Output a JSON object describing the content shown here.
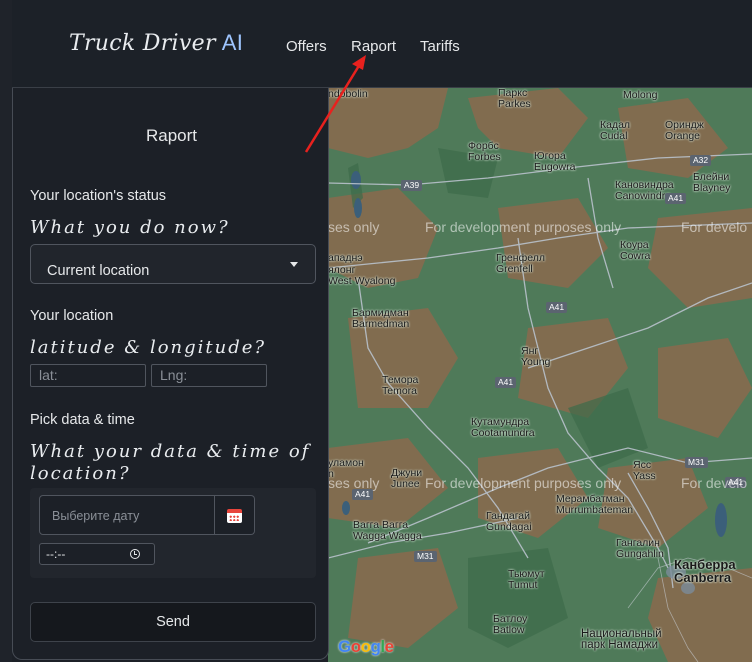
{
  "navbar": {
    "brand": "Truck Driver",
    "brand_suffix": "AI",
    "links": [
      "Offers",
      "Raport",
      "Tariffs"
    ]
  },
  "panel": {
    "title": "Raport",
    "status_label": "Your location's status",
    "status_question": "What you do now?",
    "status_select_value": "Current location",
    "location_label": "Your location",
    "location_question": "latitude & longitude?",
    "lat_placeholder": "lat:",
    "lng_placeholder": "Lng:",
    "datetime_label": "Pick data & time",
    "datetime_question": "What your data & time of location?",
    "date_placeholder": "Выберите дату",
    "time_value": "--:--",
    "send_label": "Send"
  },
  "map": {
    "watermark": "For development purposes only",
    "watermark_left": "ses only",
    "watermark_right": "For develo",
    "logo": "Google",
    "places": [
      {
        "ru": "Паркс",
        "en": "Parkes"
      },
      {
        "ru": "Molong",
        "en": ""
      },
      {
        "ru": "Кадал",
        "en": "Cudal"
      },
      {
        "ru": "Ориндж",
        "en": "Orange"
      },
      {
        "ru": "Форбс",
        "en": "Forbes"
      },
      {
        "ru": "Югора",
        "en": "Eugowra"
      },
      {
        "ru": "Кановиндра",
        "en": "Canowindra"
      },
      {
        "ru": "Блейни",
        "en": "Blayney"
      },
      {
        "ru": "Коура",
        "en": "Cowra"
      },
      {
        "ru": "Гренфелл",
        "en": "Grenfell"
      },
      {
        "ru": "ападнэ",
        "en": ""
      },
      {
        "ru": "ялонг",
        "en": "West Wyalong"
      },
      {
        "ru": "Бармидман",
        "en": "Barmedman"
      },
      {
        "ru": "Янг",
        "en": "Young"
      },
      {
        "ru": "Темора",
        "en": "Temora"
      },
      {
        "ru": "Кутамундра",
        "en": "Cootamundra"
      },
      {
        "ru": "уламон",
        "en": "n"
      },
      {
        "ru": "Джуни",
        "en": "Junee"
      },
      {
        "ru": "Ясс",
        "en": "Yass"
      },
      {
        "ru": "Мерамбатман",
        "en": "Murrumbateman"
      },
      {
        "ru": "Гандагай",
        "en": "Gundagai"
      },
      {
        "ru": "Вагга Вагга",
        "en": "Wagga Wagga"
      },
      {
        "ru": "Гангалин",
        "en": "Gungahlin"
      },
      {
        "ru": "Канберра",
        "en": "Canberra"
      },
      {
        "ru": "Тьюмут",
        "en": "Tumut"
      },
      {
        "ru": "Батлоу",
        "en": "Batlow"
      },
      {
        "ru": "Национальный",
        "en": "парк Намаджи"
      },
      {
        "ru": "ndobolin",
        "en": ""
      }
    ],
    "roads": [
      "A39",
      "A32",
      "A41",
      "A41",
      "A41",
      "A41",
      "M31",
      "A41",
      "M31",
      "A32"
    ]
  },
  "colors": {
    "annotation_arrow": "#e8211e",
    "map_green": "#4f7a59",
    "map_brown": "#8a6a4e"
  }
}
